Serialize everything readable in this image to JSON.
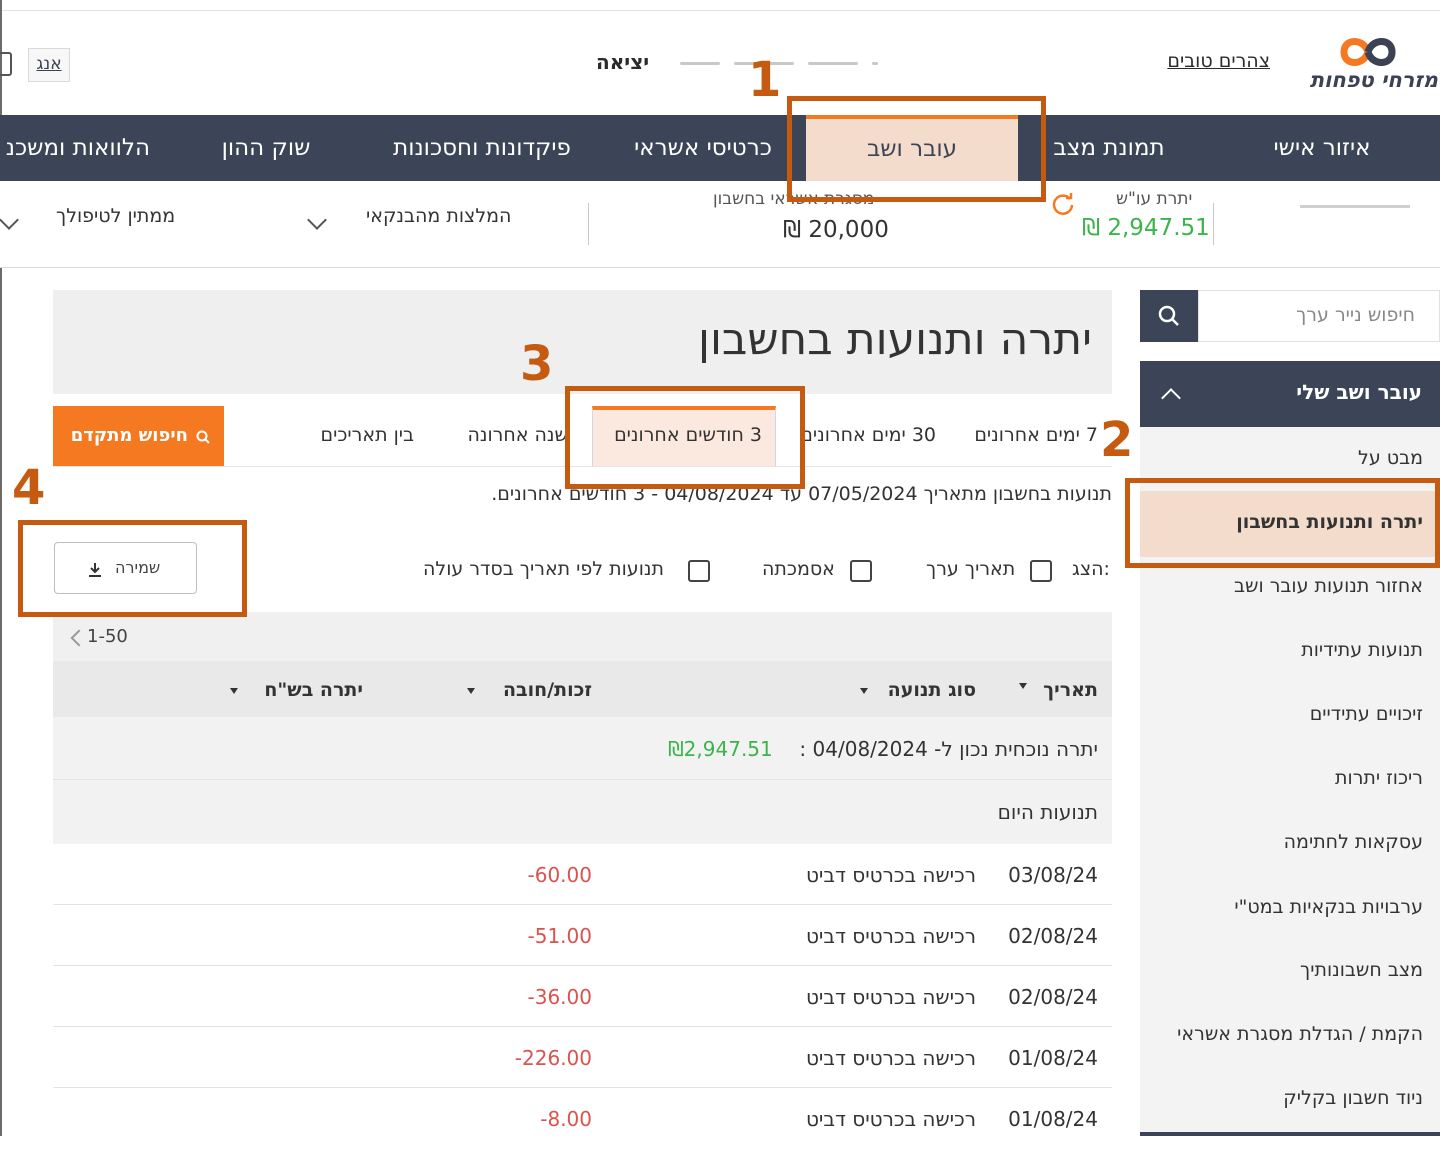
{
  "header": {
    "logo_text": "מזרחי טפחות",
    "greeting": "צהרים טובים",
    "exit_label": "יציאה",
    "lang_label": "אנג"
  },
  "nav": {
    "items": [
      "איזור אישי",
      "תמונת מצב",
      "עובר ושב",
      "כרטיסי אשראי",
      "פיקדונות וחסכונות",
      "שוק ההון",
      "הלוואות ומשכנ"
    ],
    "active_index": 2
  },
  "info": {
    "balance_label": "יתרת עו\"ש",
    "balance_value": "2,947.51 ₪",
    "credit_label": "מסגרת אשראי בחשבון",
    "credit_value": "20,000 ₪",
    "recommend_label": "המלצות מהבנקאי",
    "pending_label": "ממתין לטיפולך",
    "balance_color": "#3cb44b"
  },
  "sidebar": {
    "search_placeholder": "חיפוש נייר ערך",
    "section_title": "עובר ושב שלי",
    "items": [
      "מבט על",
      "יתרה ותנועות בחשבון",
      "אחזור תנועות עובר ושב",
      "תנועות עתידיות",
      "זיכויים עתידיים",
      "ריכוז יתרות",
      "עסקאות לחתימה",
      "ערבויות בנקאיות במט\"י",
      "מצב חשבונותיך",
      "הקמת / הגדלת מסגרת אשראי",
      "ניוד חשבון בקליק"
    ],
    "active_index": 1
  },
  "main": {
    "title": "יתרה ותנועות בחשבון",
    "tabs": [
      "7 ימים אחרונים",
      "30 ימים אחרונים",
      "3 חודשים אחרונים",
      "שנה אחרונה",
      "בין תאריכים"
    ],
    "active_tab": 2,
    "advanced_search": "חיפוש מתקדם",
    "range_text": "תנועות בחשבון מתאריך 07/05/2024 עד 04/08/2024 - 3 חודשים אחרונים.",
    "show_label": "הצג:",
    "checkboxes": [
      "תאריך ערך",
      "אסמכתה",
      "תנועות לפי תאריך בסדר עולה"
    ],
    "save_label": "שמירה"
  },
  "table": {
    "pager": "1-50",
    "columns": [
      "תאריך",
      "סוג תנועה",
      "זכות/חובה",
      "יתרה בש\"ח"
    ],
    "current_balance_label": "יתרה נוכחית נכון ל- 04/08/2024 :",
    "current_balance_value": "₪2,947.51",
    "today_label": "תנועות היום",
    "rows": [
      {
        "date": "03/08/24",
        "type": "רכישה בכרטיס דביט",
        "amount": "-60.00"
      },
      {
        "date": "02/08/24",
        "type": "רכישה בכרטיס דביט",
        "amount": "-51.00"
      },
      {
        "date": "02/08/24",
        "type": "רכישה בכרטיס דביט",
        "amount": "-36.00"
      },
      {
        "date": "01/08/24",
        "type": "רכישה בכרטיס דביט",
        "amount": "-226.00"
      },
      {
        "date": "01/08/24",
        "type": "רכישה בכרטיס דביט",
        "amount": "-8.00"
      }
    ]
  },
  "annotations": [
    "1",
    "2",
    "3",
    "4"
  ],
  "colors": {
    "accent": "#f47920",
    "nav_bg": "#3b4557",
    "active_bg": "#f3dccb",
    "annotation": "#c55a11",
    "negative": "#d9534f"
  }
}
